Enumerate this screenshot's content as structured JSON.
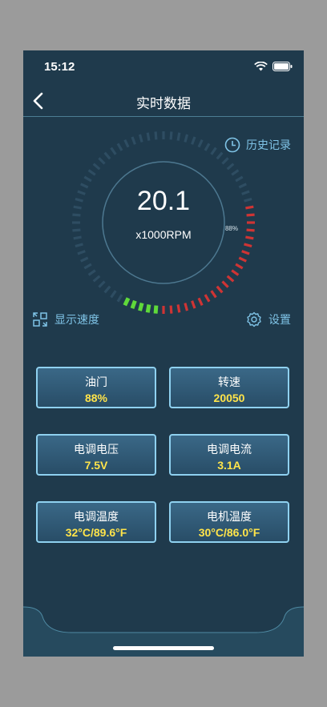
{
  "status_bar": {
    "time": "15:12"
  },
  "nav": {
    "title": "实时数据"
  },
  "history_label": "历史记录",
  "gauge": {
    "value": "20.1",
    "unit": "x1000RPM",
    "throttle_fraction": 0.88,
    "throttle_label": "88%",
    "colors": {
      "green": "#5fd93a",
      "red": "#cf3434",
      "track": "#2e4d62"
    }
  },
  "speed_label": "显示速度",
  "settings_label": "设置",
  "cards": [
    {
      "label": "油门",
      "value": "88%"
    },
    {
      "label": "转速",
      "value": "20050"
    },
    {
      "label": "电调电压",
      "value": "7.5V"
    },
    {
      "label": "电调电流",
      "value": "3.1A"
    },
    {
      "label": "电调温度",
      "value": "32°C/89.6°F"
    },
    {
      "label": "电机温度",
      "value": "30°C/86.0°F"
    }
  ],
  "accent_color": "#7fc3e6",
  "value_color": "#ffe44a"
}
